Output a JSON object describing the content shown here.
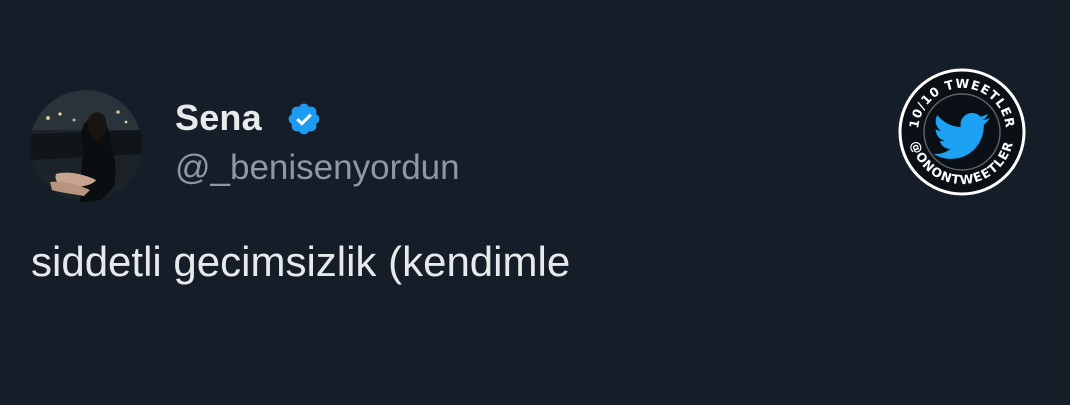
{
  "tweet": {
    "display_name": "Sena",
    "handle": "@_benisenyordun",
    "verified": true,
    "text": "siddetli gecimsizlik (kendimle"
  },
  "watermark": {
    "top_text": "10/10 TWEETLER",
    "bottom_text": "@ONONTWEETLER",
    "icon": "twitter-bird-icon"
  },
  "colors": {
    "background": "#151d28",
    "text_primary": "#e7e9ea",
    "text_secondary": "#8b98a5",
    "verified_blue": "#1d9bf0",
    "watermark_blue": "#1da1f2"
  }
}
